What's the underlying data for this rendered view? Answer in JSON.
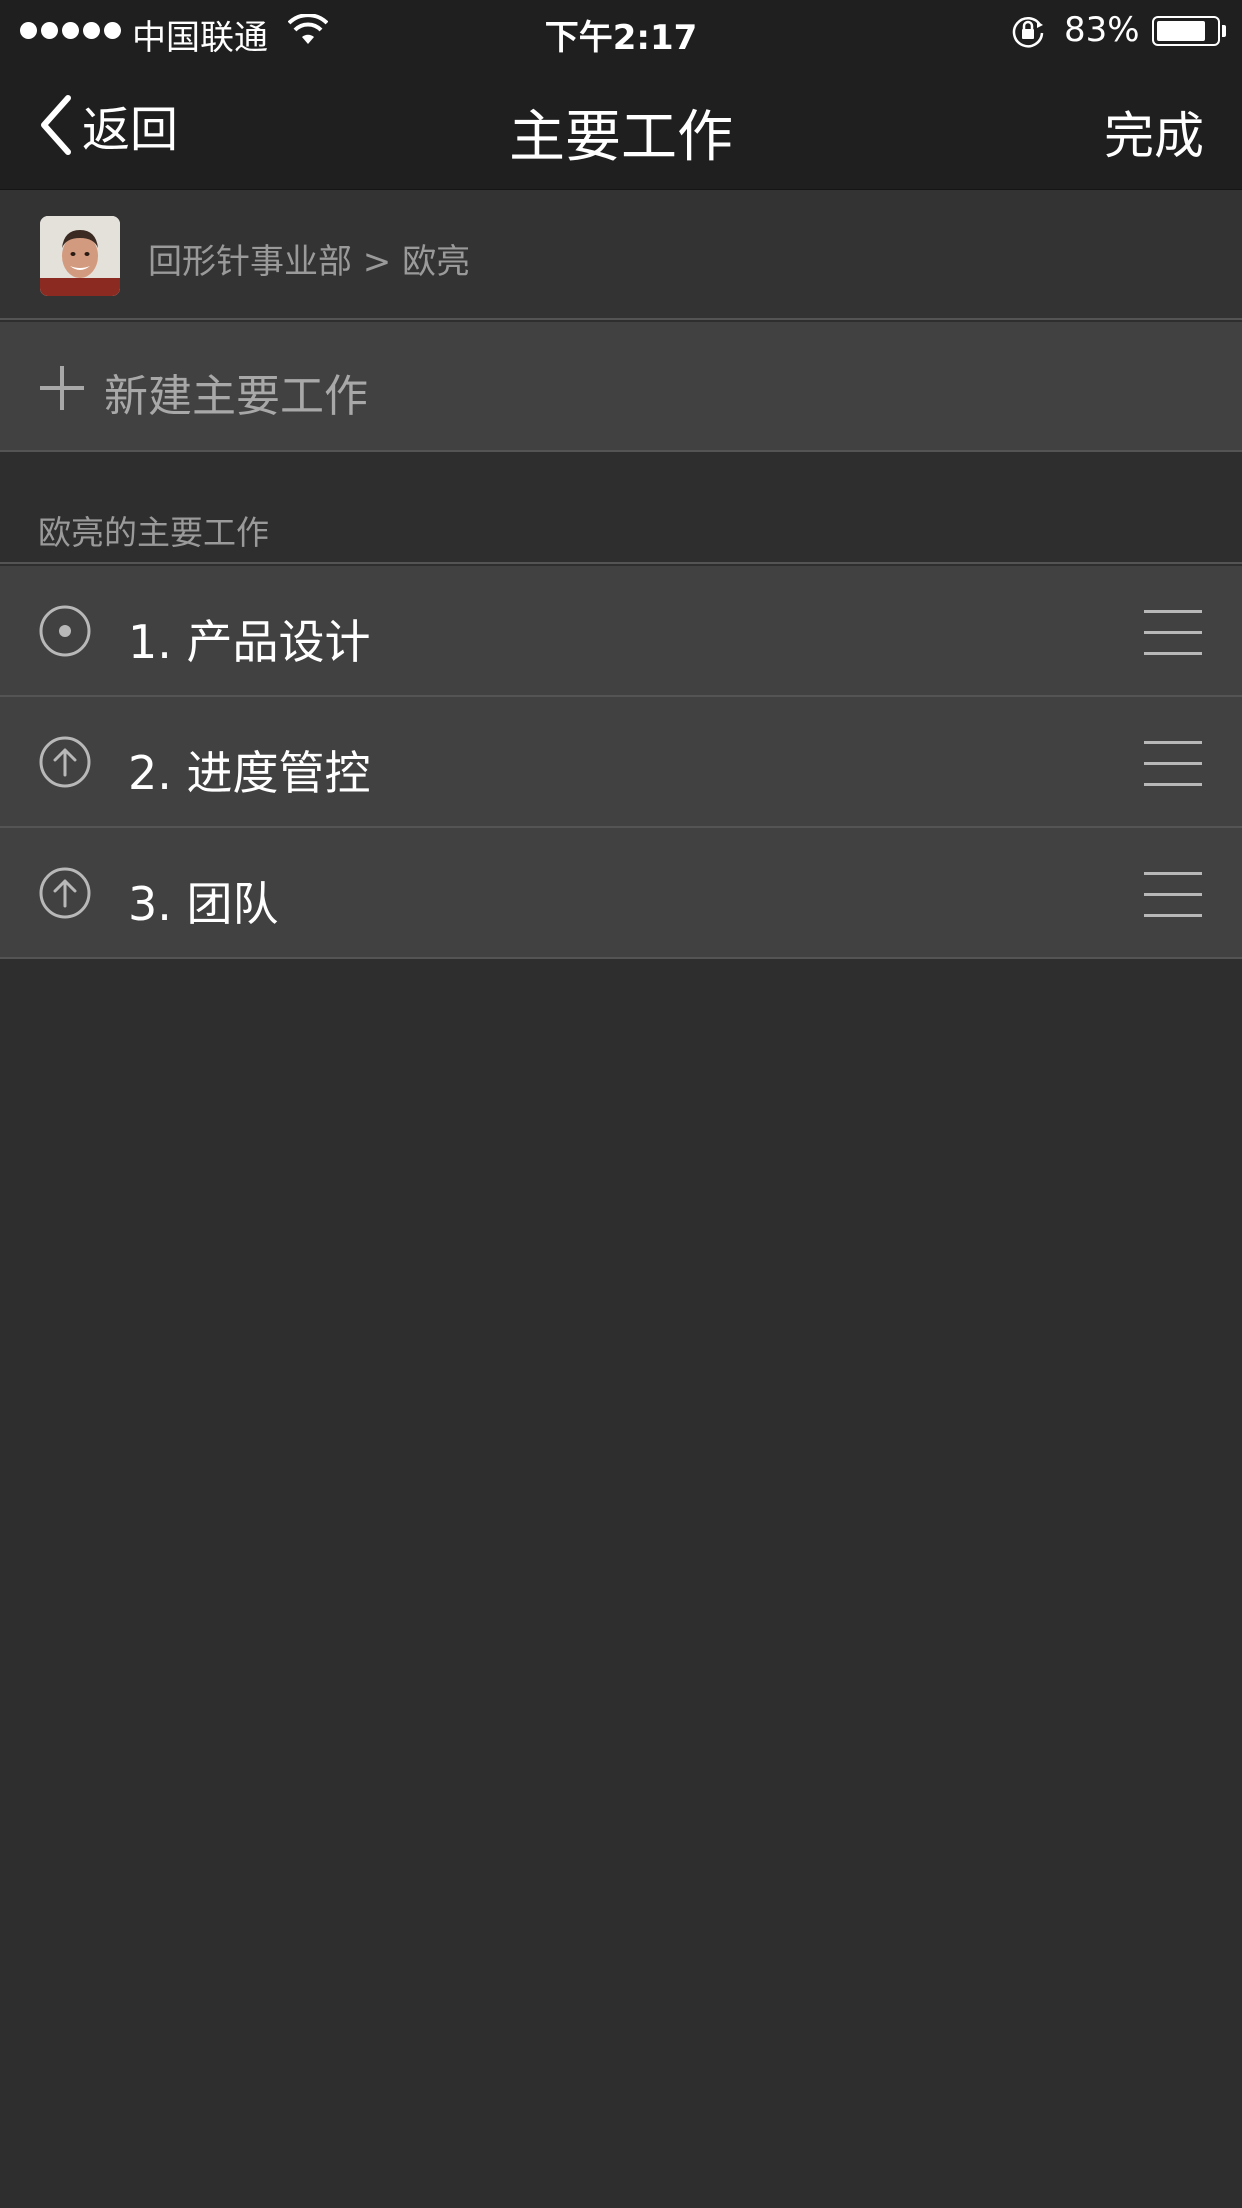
{
  "status_bar": {
    "carrier": "中国联通",
    "time": "下午2:17",
    "battery_percent": "83%",
    "battery_level": 0.83,
    "signal_bars": 5
  },
  "nav": {
    "back_label": "返回",
    "title": "主要工作",
    "done_label": "完成"
  },
  "breadcrumb": {
    "text": "回形针事业部 > 欧亮"
  },
  "new_item": {
    "label": "新建主要工作"
  },
  "section": {
    "title": "欧亮的主要工作"
  },
  "items": [
    {
      "label": "1. 产品设计",
      "icon": "target-dot-icon"
    },
    {
      "label": "2. 进度管控",
      "icon": "arrow-up-circle-icon"
    },
    {
      "label": "3. 团队",
      "icon": "arrow-up-circle-icon"
    }
  ],
  "colors": {
    "background": "#2e2e2e",
    "bar": "#1f1f1f",
    "row": "#414141",
    "separator": "#545454",
    "muted_text": "#9a9a9a"
  }
}
